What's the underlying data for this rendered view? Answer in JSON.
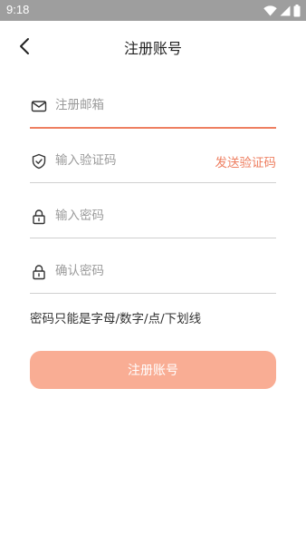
{
  "status_bar": {
    "time": "9:18",
    "icons": [
      "wifi-icon",
      "signal-icon",
      "battery-icon"
    ]
  },
  "header": {
    "back_icon": "chevron-left-icon",
    "title": "注册账号"
  },
  "form": {
    "email": {
      "icon": "envelope-icon",
      "placeholder": "注册邮箱",
      "value": ""
    },
    "code": {
      "icon": "shield-icon",
      "placeholder": "输入验证码",
      "value": "",
      "send_label": "发送验证码"
    },
    "password": {
      "icon": "lock-icon",
      "placeholder": "输入密码",
      "value": ""
    },
    "confirm": {
      "icon": "lock-icon",
      "placeholder": "确认密码",
      "value": ""
    },
    "hint": "密码只能是字母/数字/点/下划线",
    "submit_label": "注册账号"
  },
  "colors": {
    "accent": "#ee7f61",
    "button": "#f9ad94",
    "status_bar": "#9e9e9e"
  }
}
